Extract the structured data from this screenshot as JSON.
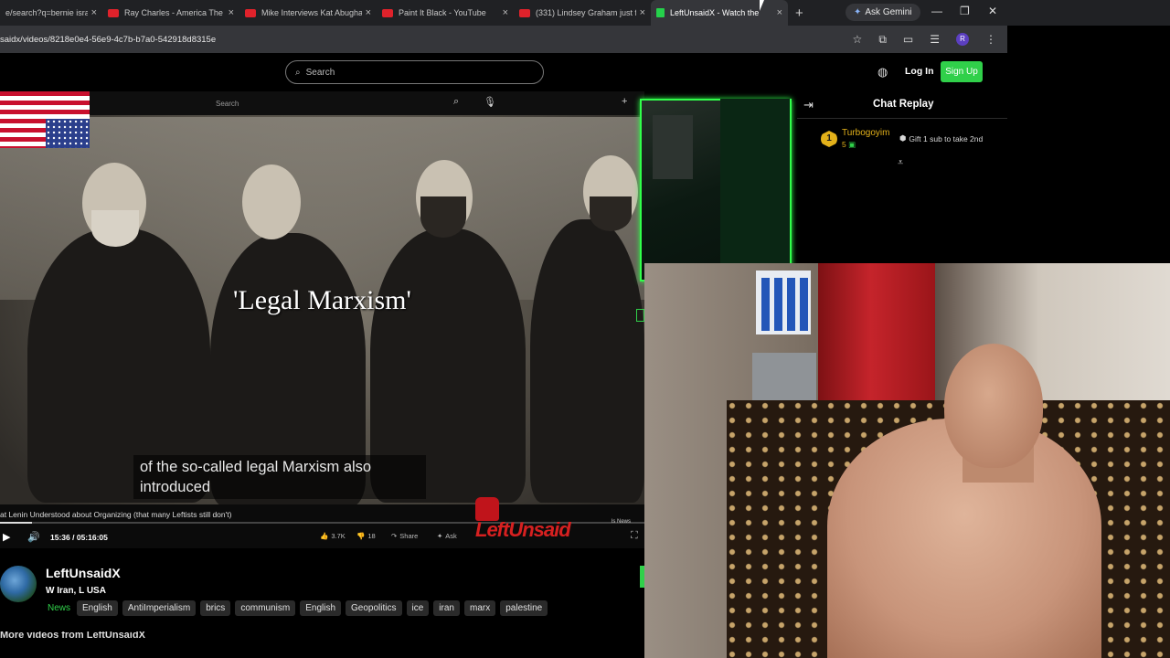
{
  "browser": {
    "tabs": [
      {
        "title": "e/search?q=bernie isra",
        "favicon": "youtube",
        "active": false
      },
      {
        "title": "Ray Charles - America The B",
        "favicon": "youtube",
        "active": false
      },
      {
        "title": "Mike Interviews Kat Abugha",
        "favicon": "youtube",
        "active": false
      },
      {
        "title": "Paint It Black - YouTube",
        "favicon": "youtube",
        "active": false
      },
      {
        "title": "(331) Lindsey Graham just f",
        "favicon": "youtube",
        "active": false
      },
      {
        "title": "LeftUnsaidX - Watch the",
        "favicon": "kick",
        "active": true
      }
    ],
    "close_glyph": "×",
    "new_tab_glyph": "+",
    "ask_gemini": "Ask Gemini",
    "url": "saidx/videos/8218e0e4-56e9-4c7b-b7a0-542918d8315e",
    "profile_initial": "R"
  },
  "site": {
    "search_placeholder": "Search",
    "login": "Log In",
    "signup": "Sign Up",
    "accent": "#30d04a"
  },
  "video": {
    "inner_search_placeholder": "Search",
    "overlay_title": "'Legal Marxism'",
    "caption": "of the so-called legal Marxism also introduced",
    "video_title": "at Lenin Understood about Organizing (that many Leftists still don't)",
    "time_current": "15:36",
    "time_total": "05:16:05",
    "progress_fraction": 0.05,
    "likes": "3.7K",
    "dislikes": "18",
    "share": "Share",
    "ask": "Ask",
    "logo_text": "LeftUnsaid",
    "news_tag": "ls News"
  },
  "chat": {
    "title": "Chat Replay",
    "gifter": {
      "rank": "1",
      "name": "Turbogoyim",
      "count": "5"
    },
    "gift_text": "Gift 1 sub to take 2nd"
  },
  "channel": {
    "name": "LeftUnsaidX",
    "subtitle": "W Iran, L USA",
    "tags": [
      "News",
      "English",
      "AntiImperialism",
      "brics",
      "communism",
      "English",
      "Geopolitics",
      "ice",
      "iran",
      "marx",
      "palestine"
    ],
    "more_videos": "More videos from LeftUnsaidX"
  }
}
